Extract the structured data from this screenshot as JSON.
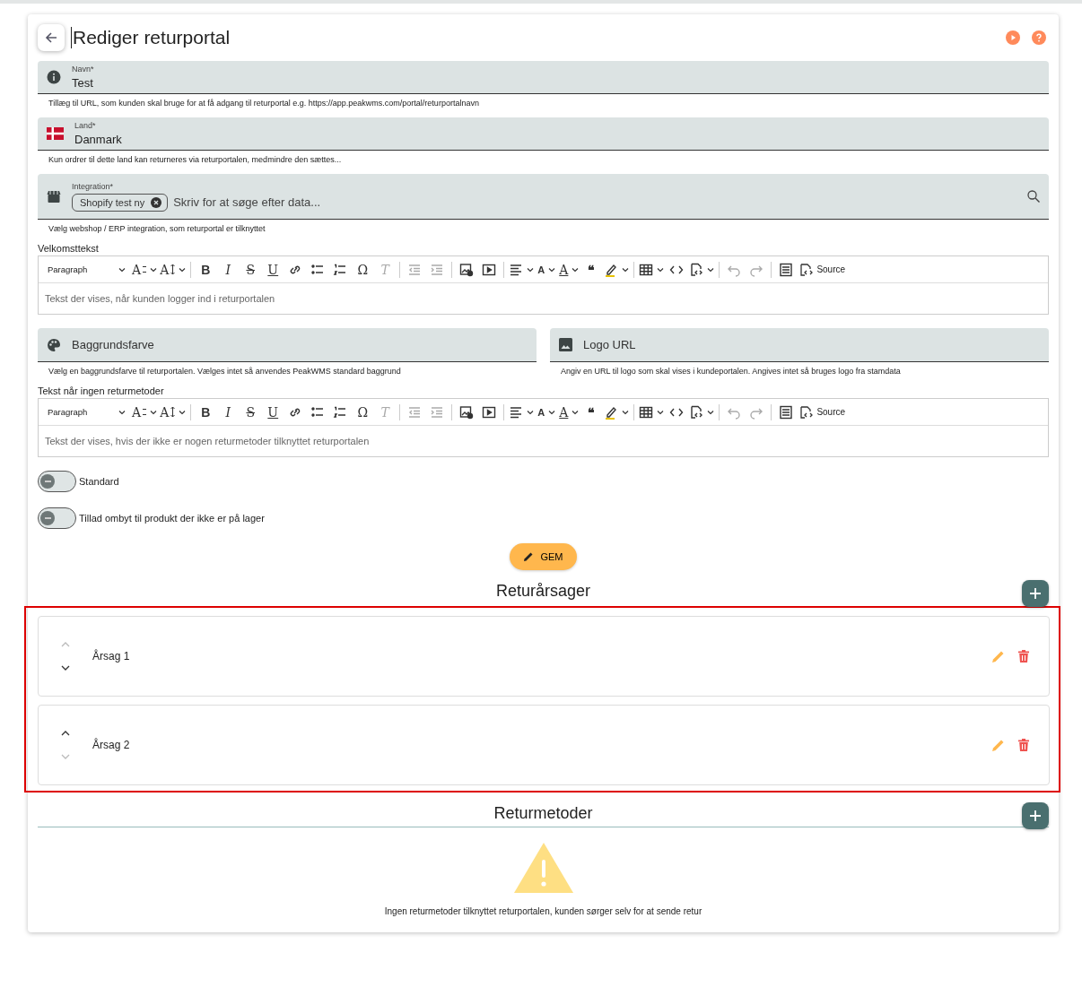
{
  "header": {
    "title": "Rediger returportal"
  },
  "fields": [
    {
      "kind": "info",
      "label": "Navn*",
      "value": "Test",
      "hint": "Tillæg til URL, som kunden skal bruge for at få adgang til returportal e.g. https://app.peakwms.com/portal/returportalnavn"
    },
    {
      "kind": "country",
      "label": "Land*",
      "value": "Danmark",
      "hint": "Kun ordrer til dette land kan returneres via returportalen, medmindre den sættes..."
    },
    {
      "kind": "integration",
      "label": "Integration*",
      "chips": [
        "Shopify test ny"
      ],
      "placeholder": "Skriv for at søge efter data...",
      "hint": "Vælg webshop / ERP integration, som returportal er tilknyttet"
    }
  ],
  "welcome_editor": {
    "label": "Velkomsttekst",
    "toolbar": {
      "paragraph": "Paragraph",
      "glyphs": [
        "A",
        "A",
        "B",
        "I",
        "S",
        "U",
        "Ω",
        "T",
        "A",
        "A",
        "❝"
      ],
      "source": "Source"
    },
    "placeholder": "Tekst der vises, når kunden logger ind i returportalen"
  },
  "half_fields": [
    {
      "kind": "color",
      "label": "Baggrundsfarve",
      "hint": "Vælg en baggrundsfarve til returportalen. Vælges intet så anvendes PeakWMS standard baggrund"
    },
    {
      "kind": "image",
      "label": "Logo URL",
      "hint": "Angiv en URL til logo som skal vises i kundeportalen. Angives intet så bruges logo fra stamdata"
    }
  ],
  "no_methods_editor": {
    "label": "Tekst når ingen returmetoder",
    "toolbar": {
      "paragraph": "Paragraph",
      "glyphs": [
        "A",
        "A",
        "B",
        "I",
        "S",
        "U",
        "Ω",
        "T",
        "A",
        "A",
        "❝"
      ],
      "source": "Source"
    },
    "placeholder": "Tekst der vises, hvis der ikke er nogen returmetoder tilknyttet returportalen"
  },
  "toggles": [
    {
      "label": "Standard",
      "on": false
    },
    {
      "label": "Tillad ombyt til produkt der ikke er på lager",
      "on": false
    }
  ],
  "save_button": "GEM",
  "reasons": {
    "title": "Returårsager",
    "highlighted": true,
    "items": [
      {
        "name": "Årsag 1",
        "can_move_up": false,
        "can_move_down": true
      },
      {
        "name": "Årsag 2",
        "can_move_up": true,
        "can_move_down": false
      }
    ]
  },
  "methods": {
    "title": "Returmetoder",
    "empty_text": "Ingen returmetoder tilknyttet returportalen, kunden sørger selv for at sende retur"
  }
}
